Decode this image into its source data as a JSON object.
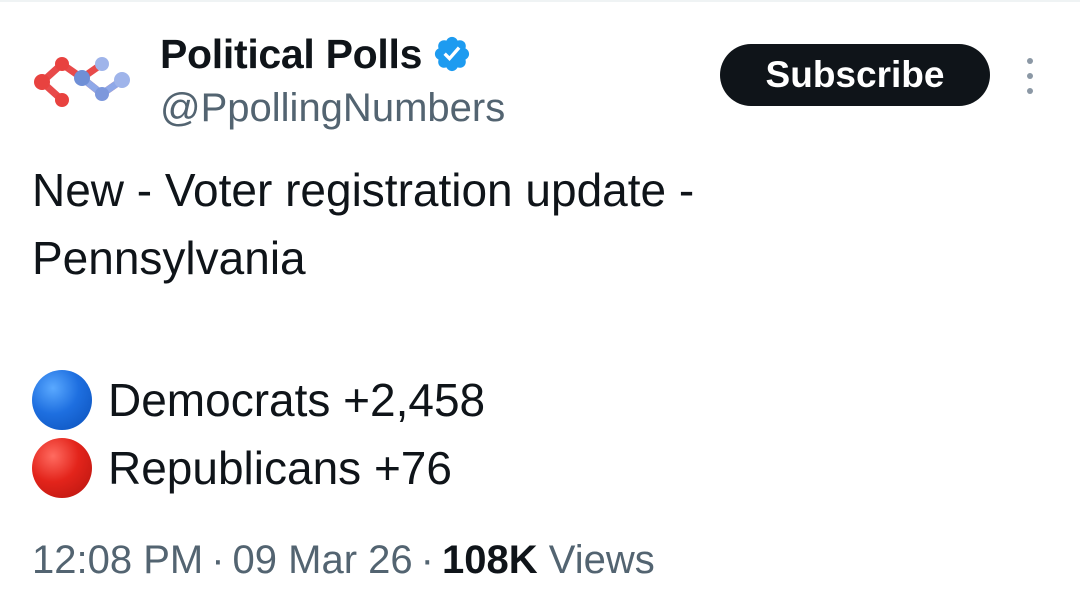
{
  "author": {
    "display_name": "Political Polls",
    "handle": "@PpollingNumbers",
    "verified": true,
    "avatar_icon": "network-nodes-logo"
  },
  "actions": {
    "subscribe_label": "Subscribe",
    "more_icon": "vertical-ellipsis-icon"
  },
  "post": {
    "line1": "New - Voter registration update -",
    "line2": "Pennsylvania",
    "stats": [
      {
        "icon": "blue-circle-emoji",
        "color": "#1e6fe0",
        "text": "Democrats +2,458"
      },
      {
        "icon": "red-circle-emoji",
        "color": "#e3241b",
        "text": "Republicans +76"
      }
    ]
  },
  "meta": {
    "time": "12:08 PM",
    "separator": "·",
    "date": "09 Mar 26",
    "views_count": "108K",
    "views_label": "Views"
  },
  "colors": {
    "text": "#0f1419",
    "secondary": "#536471",
    "verified_blue": "#1d9bf0",
    "button_bg": "#0f1419"
  }
}
